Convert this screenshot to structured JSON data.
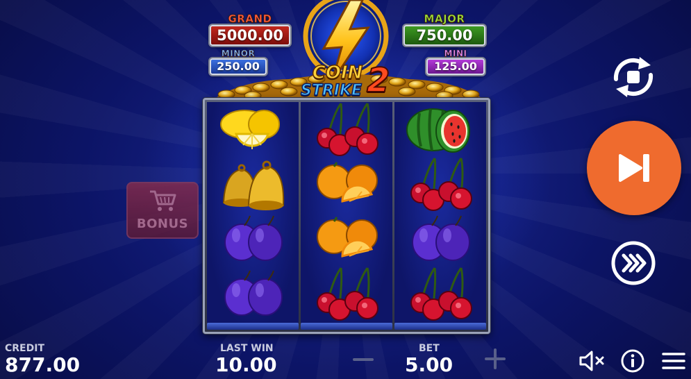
{
  "jackpots": {
    "grand": {
      "label": "GRAND",
      "value": "5000.00"
    },
    "major": {
      "label": "MAJOR",
      "value": "750.00"
    },
    "minor": {
      "label": "MINOR",
      "value": "250.00"
    },
    "mini": {
      "label": "MINI",
      "value": "125.00"
    }
  },
  "logo": {
    "line1": "COIN",
    "line2": "STRIKE",
    "number": "2"
  },
  "reels": [
    [
      "lemon",
      "bell",
      "plum",
      "plum"
    ],
    [
      "cherry",
      "orange",
      "orange",
      "cherry"
    ],
    [
      "watermelon",
      "cherry",
      "plum",
      "cherry"
    ]
  ],
  "bonus": {
    "label": "BONUS",
    "icon": "shopping-cart-icon"
  },
  "controls": {
    "autoplay_icon": "autoplay-icon",
    "spin_icon": "skip-play-icon",
    "turbo_icon": "fast-forward-icon"
  },
  "footer": {
    "credit_label": "CREDIT",
    "credit_value": "877.00",
    "last_win_label": "LAST WIN",
    "last_win_value": "10.00",
    "bet_label": "BET",
    "bet_value": "5.00",
    "sound_icon": "sound-muted-icon",
    "info_icon": "info-icon",
    "menu_icon": "hamburger-menu-icon"
  },
  "colors": {
    "spin_button": "#ef6b2e",
    "background": "#0c1466",
    "grand": "#c2281e",
    "major": "#3d9a22",
    "minor": "#3b6fe0",
    "mini": "#b33ad8"
  }
}
